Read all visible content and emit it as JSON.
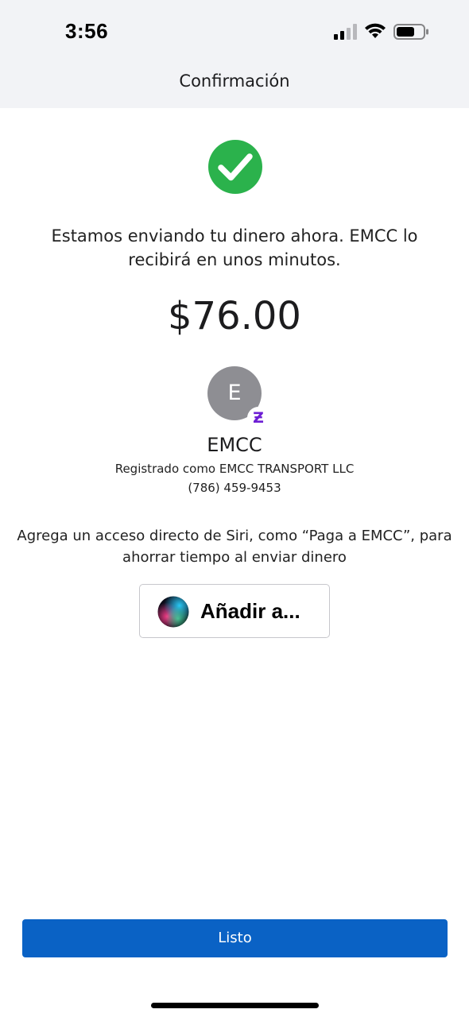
{
  "status_bar": {
    "time": "3:56",
    "icons": [
      "signal-icon",
      "wifi-icon",
      "battery-icon"
    ]
  },
  "nav": {
    "title": "Confirmación"
  },
  "confirmation": {
    "icon": "check-circle-icon",
    "icon_color": "#2bb24c",
    "message": "Estamos enviando tu dinero ahora. EMCC lo recibirá en unos minutos.",
    "amount": "$76.00"
  },
  "recipient": {
    "initial": "E",
    "badge_glyph": "Ƶ",
    "badge_color": "#6d1ed4",
    "name": "EMCC",
    "registered_as": "Registrado como EMCC TRANSPORT LLC",
    "phone": "(786) 459-9453"
  },
  "siri": {
    "prompt": "Agrega un acceso directo de Siri, como “Paga a EMCC”, para ahorrar tiempo al enviar dinero",
    "button_label": "Añadir a...",
    "icon": "siri-icon"
  },
  "footer": {
    "done_label": "Listo",
    "accent": "#0a62c5"
  }
}
